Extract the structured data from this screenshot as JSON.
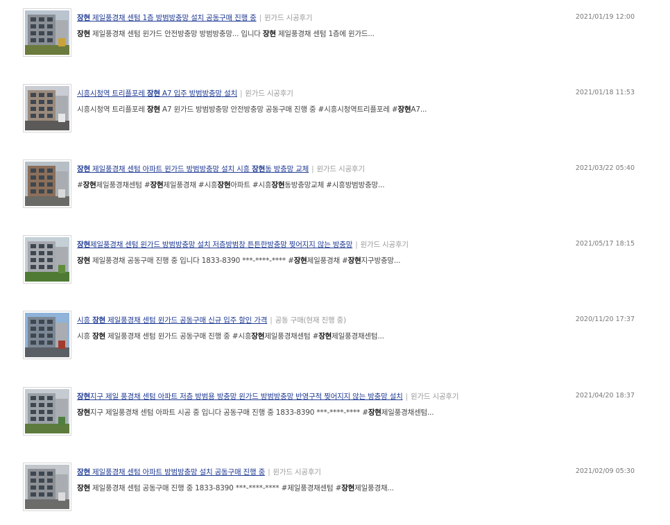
{
  "results": [
    {
      "title_parts": [
        {
          "t": "장현",
          "b": true
        },
        {
          "t": " 제일풍경채 센텀 1층 방범방충망 설치 공동구매 진행 중",
          "b": false
        }
      ],
      "category": "윈가드 시공후기",
      "date": "2021/01/19 12:00",
      "snippet_parts": [
        {
          "t": "장현",
          "b": true
        },
        {
          "t": " 제일풍경채 센텀 윈가드 안전방충망 방범방충망... 입니다 ",
          "b": false
        },
        {
          "t": "장현",
          "b": true
        },
        {
          "t": " 제일풍경채 센텀 1층에 윈가드...",
          "b": false
        }
      ],
      "thumb": "building-photo-1"
    },
    {
      "title_parts": [
        {
          "t": "시흥시청역 트리플포레 ",
          "b": false
        },
        {
          "t": "장현",
          "b": true
        },
        {
          "t": " A7 입주 방범방충망 설치",
          "b": false
        }
      ],
      "category": "윈가드 시공후기",
      "date": "2021/01/18 11:53",
      "snippet_parts": [
        {
          "t": "시흥시청역 트리플포레 ",
          "b": false
        },
        {
          "t": "장현",
          "b": true
        },
        {
          "t": " A7 윈가드 방범방충망 안전방충망 공동구매 진행 중 #시흥시청역트리플포레 #",
          "b": false
        },
        {
          "t": "장현",
          "b": true
        },
        {
          "t": "A7...",
          "b": false
        }
      ],
      "thumb": "building-photo-2"
    },
    {
      "title_parts": [
        {
          "t": "장현",
          "b": true
        },
        {
          "t": " 제일풍경채 센텀 아파트 윈가드 방범방충망 설치 시흥 ",
          "b": false
        },
        {
          "t": "장현",
          "b": true
        },
        {
          "t": "동 방충망 교체",
          "b": false
        }
      ],
      "category": "윈가드 시공후기",
      "date": "2021/03/22 05:40",
      "snippet_parts": [
        {
          "t": "#",
          "b": false
        },
        {
          "t": "장현",
          "b": true
        },
        {
          "t": "제일풍경채센텀 #",
          "b": false
        },
        {
          "t": "장현",
          "b": true
        },
        {
          "t": "제일풍경채 #시흥",
          "b": false
        },
        {
          "t": "장현",
          "b": true
        },
        {
          "t": "아파트 #시흥",
          "b": false
        },
        {
          "t": "장현",
          "b": true
        },
        {
          "t": "동방충망교체 #시흥방범방충망...",
          "b": false
        }
      ],
      "thumb": "building-photo-3"
    },
    {
      "title_parts": [
        {
          "t": "장현",
          "b": true
        },
        {
          "t": "제일풍경채 센텀 윈가드 방범방충망 설치 저층방범창 튼튼한방충망 찢어지지 않는 방충망",
          "b": false
        }
      ],
      "category": "윈가드 시공후기",
      "date": "2021/05/17 18:15",
      "snippet_parts": [
        {
          "t": "장현",
          "b": true
        },
        {
          "t": " 제일풍경채 공동구매 진행 중 입니다 1833-8390 ***-****-**** #",
          "b": false
        },
        {
          "t": "장현",
          "b": true
        },
        {
          "t": "제일풍경채 #",
          "b": false
        },
        {
          "t": "장현",
          "b": true
        },
        {
          "t": "지구방충망...",
          "b": false
        }
      ],
      "thumb": "building-photo-4"
    },
    {
      "title_parts": [
        {
          "t": "시흥 ",
          "b": false
        },
        {
          "t": "장현",
          "b": true
        },
        {
          "t": " 제일풍경채 센텀 윈가드 공동구매 신규 입주 할인 가격",
          "b": false
        }
      ],
      "category": "공동 구매(현재 진행 중)",
      "date": "2020/11/20 17:37",
      "snippet_parts": [
        {
          "t": "시흥 ",
          "b": false
        },
        {
          "t": "장현",
          "b": true
        },
        {
          "t": " 제일풍경채 센텀 윈가드 공동구매 진행 중 #시흥",
          "b": false
        },
        {
          "t": "장현",
          "b": true
        },
        {
          "t": "제일풍경채센텀 #",
          "b": false
        },
        {
          "t": "장현",
          "b": true
        },
        {
          "t": "제일풍경채센텀...",
          "b": false
        }
      ],
      "thumb": "building-photo-5"
    },
    {
      "title_parts": [
        {
          "t": "장현",
          "b": true
        },
        {
          "t": "지구 제일 풍경채 센텀 아파트 저층 방범용 방충망 윈가드 방범방충망 반영구적 찢어지지 않는 방충망 설치",
          "b": false
        }
      ],
      "category": "윈가드 시공후기",
      "date": "2021/04/20 18:37",
      "snippet_parts": [
        {
          "t": "장현",
          "b": true
        },
        {
          "t": "지구 제일풍경채 센텀 아파트 시공 중 입니다 공동구매 진행 중 1833-8390 ***-****-**** #",
          "b": false
        },
        {
          "t": "장현",
          "b": true
        },
        {
          "t": "제일풍경채센텀...",
          "b": false
        }
      ],
      "thumb": "building-photo-6"
    },
    {
      "title_parts": [
        {
          "t": "장현",
          "b": true
        },
        {
          "t": " 제일풍경채 센텀 아파트 방범방충망 설치 공동구매 진행 중",
          "b": false
        }
      ],
      "category": "윈가드 시공후기",
      "date": "2021/02/09 05:30",
      "snippet_parts": [
        {
          "t": "장현",
          "b": true
        },
        {
          "t": " 제일풍경채 센텀 공동구매 진행 중 1833-8390 ***-****-**** #제일풍경채센텀 #",
          "b": false
        },
        {
          "t": "장현",
          "b": true
        },
        {
          "t": "제일풍경채...",
          "b": false
        }
      ],
      "thumb": "building-photo-7"
    }
  ],
  "colors": {
    "link": "#1f3a93",
    "category": "#999999",
    "date": "#777777",
    "snippet": "#444444"
  }
}
